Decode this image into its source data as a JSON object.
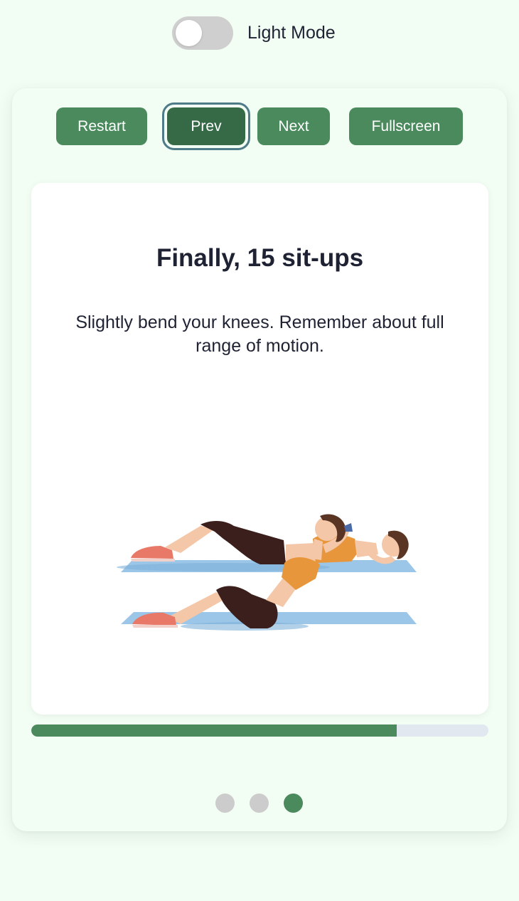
{
  "theme": {
    "label": "Light Mode",
    "dark_enabled": false
  },
  "controls": {
    "restart_label": "Restart",
    "prev_label": "Prev",
    "next_label": "Next",
    "fullscreen_label": "Fullscreen"
  },
  "slide": {
    "title": "Finally, 15 sit-ups",
    "description": "Slightly bend your knees. Remember about full range of motion.",
    "illustration": "sit-ups-illustration"
  },
  "progress": {
    "fraction": 0.8
  },
  "pagination": {
    "total": 3,
    "current": 3
  },
  "colors": {
    "accent": "#4a8a5d",
    "accent_active": "#366a47",
    "background": "#f2fdf3",
    "track": "#e2e8f0",
    "dot_inactive": "#cccccc"
  }
}
